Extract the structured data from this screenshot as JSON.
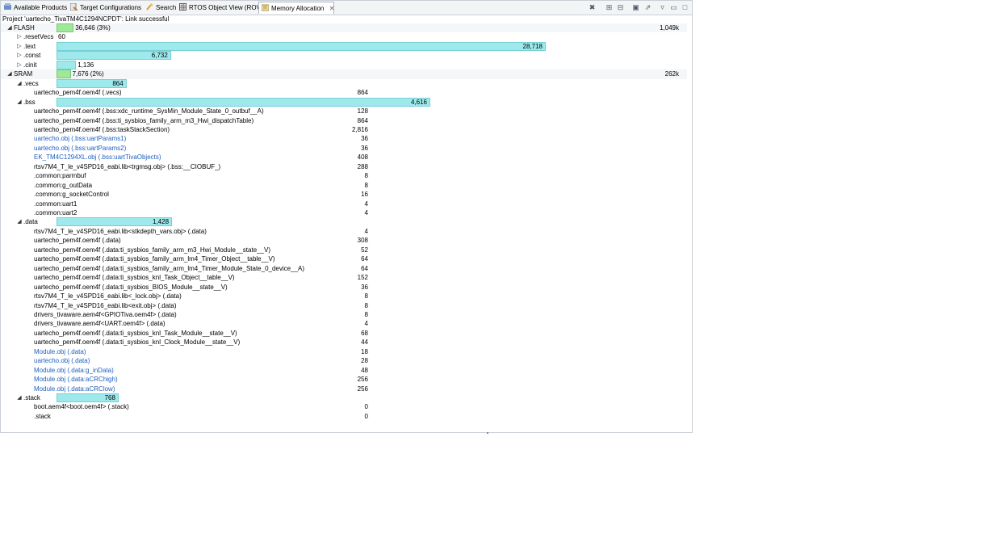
{
  "tabs": [
    {
      "label": "Available Products",
      "icon": "products-icon",
      "active": false
    },
    {
      "label": "Target Configurations",
      "icon": "target-config-icon",
      "active": false
    },
    {
      "label": "Search",
      "icon": "search-icon",
      "active": false
    },
    {
      "label": "RTOS Object View (ROV)",
      "icon": "rov-grid-icon",
      "active": false
    },
    {
      "label": "Memory Allocation",
      "icon": "memory-icon",
      "active": true
    }
  ],
  "toolbar": [
    "clear-icon",
    "expand-all-icon",
    "collapse-all-icon",
    "new-view-icon",
    "export-icon",
    "view-menu-icon",
    "minimize-icon",
    "maximize-icon"
  ],
  "status": "Project 'uartecho_TivaTM4C1294NCPDT': Link successful",
  "memory": {
    "colors": {
      "usage_bar": "#9de9ec",
      "region_bar": "#9ee89a",
      "link": "#1f5fbf"
    },
    "rows": [
      {
        "level": 0,
        "arrow": "expanded",
        "name": "FLASH",
        "bar": "green",
        "fill": 0.035,
        "bar_label": "36,646 (3%)",
        "total": "1,049k"
      },
      {
        "level": 1,
        "arrow": "collapsed",
        "name": ".resetVecs",
        "bar": "green",
        "fill": 0.0,
        "bar_label": "60"
      },
      {
        "level": 1,
        "arrow": "collapsed",
        "name": ".text",
        "bar": "cyan",
        "fill": 1.0,
        "bar_label": "28,718"
      },
      {
        "level": 1,
        "arrow": "collapsed",
        "name": ".const",
        "bar": "cyan",
        "fill": 0.234,
        "bar_label": "6,732"
      },
      {
        "level": 1,
        "arrow": "collapsed",
        "name": ".cinit",
        "bar": "cyan",
        "fill": 0.04,
        "bar_label": "1,136"
      },
      {
        "level": 0,
        "arrow": "expanded",
        "name": "SRAM",
        "bar": "green",
        "fill": 0.029,
        "bar_label": "7,676 (2%)",
        "total": "262k"
      },
      {
        "level": 1,
        "arrow": "expanded",
        "name": ".vecs",
        "bar": "cyan",
        "fill": 0.143,
        "bar_label": "864"
      },
      {
        "level": 2,
        "name": "uartecho_pem4f.oem4f (.vecs)",
        "size": "864"
      },
      {
        "level": 1,
        "arrow": "expanded",
        "name": ".bss",
        "bar": "cyan",
        "fill": 0.764,
        "bar_label": "4,616"
      },
      {
        "level": 2,
        "name": "uartecho_pem4f.oem4f (.bss:xdc_runtime_SysMin_Module_State_0_outbuf__A)",
        "size": "128"
      },
      {
        "level": 2,
        "name": "uartecho_pem4f.oem4f (.bss:ti_sysbios_family_arm_m3_Hwi_dispatchTable)",
        "size": "864"
      },
      {
        "level": 2,
        "name": "uartecho_pem4f.oem4f (.bss:taskStackSection)",
        "size": "2,816"
      },
      {
        "level": 2,
        "name": "uartecho.obj (.bss:uartParams1)",
        "size": "36",
        "link": true
      },
      {
        "level": 2,
        "name": "uartecho.obj (.bss:uartParams2)",
        "size": "36",
        "link": true
      },
      {
        "level": 2,
        "name": "EK_TM4C1294XL.obj (.bss:uartTivaObjects)",
        "size": "408",
        "link": true
      },
      {
        "level": 2,
        "name": "rtsv7M4_T_le_v4SPD16_eabi.lib<trgmsg.obj> (.bss:__CIOBUF_)",
        "size": "288"
      },
      {
        "level": 2,
        "name": ".common:parmbuf",
        "size": "8"
      },
      {
        "level": 2,
        "name": ".common:g_outData",
        "size": "8"
      },
      {
        "level": 2,
        "name": ".common:g_socketControl",
        "size": "16"
      },
      {
        "level": 2,
        "name": ".common:uart1",
        "size": "4"
      },
      {
        "level": 2,
        "name": ".common:uart2",
        "size": "4"
      },
      {
        "level": 1,
        "arrow": "expanded",
        "name": ".data",
        "bar": "cyan",
        "fill": 0.236,
        "bar_label": "1,428"
      },
      {
        "level": 2,
        "name": "rtsv7M4_T_le_v4SPD16_eabi.lib<stkdepth_vars.obj> (.data)",
        "size": "4"
      },
      {
        "level": 2,
        "name": "uartecho_pem4f.oem4f (.data)",
        "size": "308"
      },
      {
        "level": 2,
        "name": "uartecho_pem4f.oem4f (.data:ti_sysbios_family_arm_m3_Hwi_Module__state__V)",
        "size": "52"
      },
      {
        "level": 2,
        "name": "uartecho_pem4f.oem4f (.data:ti_sysbios_family_arm_lm4_Timer_Object__table__V)",
        "size": "64"
      },
      {
        "level": 2,
        "name": "uartecho_pem4f.oem4f (.data:ti_sysbios_family_arm_lm4_Timer_Module_State_0_device__A)",
        "size": "64"
      },
      {
        "level": 2,
        "name": "uartecho_pem4f.oem4f (.data:ti_sysbios_knl_Task_Object__table__V)",
        "size": "152"
      },
      {
        "level": 2,
        "name": "uartecho_pem4f.oem4f (.data:ti_sysbios_BIOS_Module__state__V)",
        "size": "36"
      },
      {
        "level": 2,
        "name": "rtsv7M4_T_le_v4SPD16_eabi.lib<_lock.obj> (.data)",
        "size": "8"
      },
      {
        "level": 2,
        "name": "rtsv7M4_T_le_v4SPD16_eabi.lib<exit.obj> (.data)",
        "size": "8"
      },
      {
        "level": 2,
        "name": "drivers_tivaware.aem4f<GPIOTiva.oem4f> (.data)",
        "size": "8"
      },
      {
        "level": 2,
        "name": "drivers_tivaware.aem4f<UART.oem4f> (.data)",
        "size": "4"
      },
      {
        "level": 2,
        "name": "uartecho_pem4f.oem4f (.data:ti_sysbios_knl_Task_Module__state__V)",
        "size": "68"
      },
      {
        "level": 2,
        "name": "uartecho_pem4f.oem4f (.data:ti_sysbios_knl_Clock_Module__state__V)",
        "size": "44"
      },
      {
        "level": 2,
        "name": "Module.obj (.data)",
        "size": "18",
        "link": true
      },
      {
        "level": 2,
        "name": "uartecho.obj (.data)",
        "size": "28",
        "link": true
      },
      {
        "level": 2,
        "name": "Module.obj (.data:g_inData)",
        "size": "48",
        "link": true
      },
      {
        "level": 2,
        "name": "Module.obj (.data:aCRChigh)",
        "size": "256",
        "link": true
      },
      {
        "level": 2,
        "name": "Module.obj (.data:aCRClow)",
        "size": "256",
        "link": true
      },
      {
        "level": 1,
        "arrow": "expanded",
        "name": ".stack",
        "bar": "cyan",
        "fill": 0.127,
        "bar_label": "768"
      },
      {
        "level": 2,
        "name": "boot.aem4f<boot.oem4f> (.stack)",
        "size": "0"
      },
      {
        "level": 2,
        "name": ".stack",
        "size": "0"
      }
    ]
  }
}
